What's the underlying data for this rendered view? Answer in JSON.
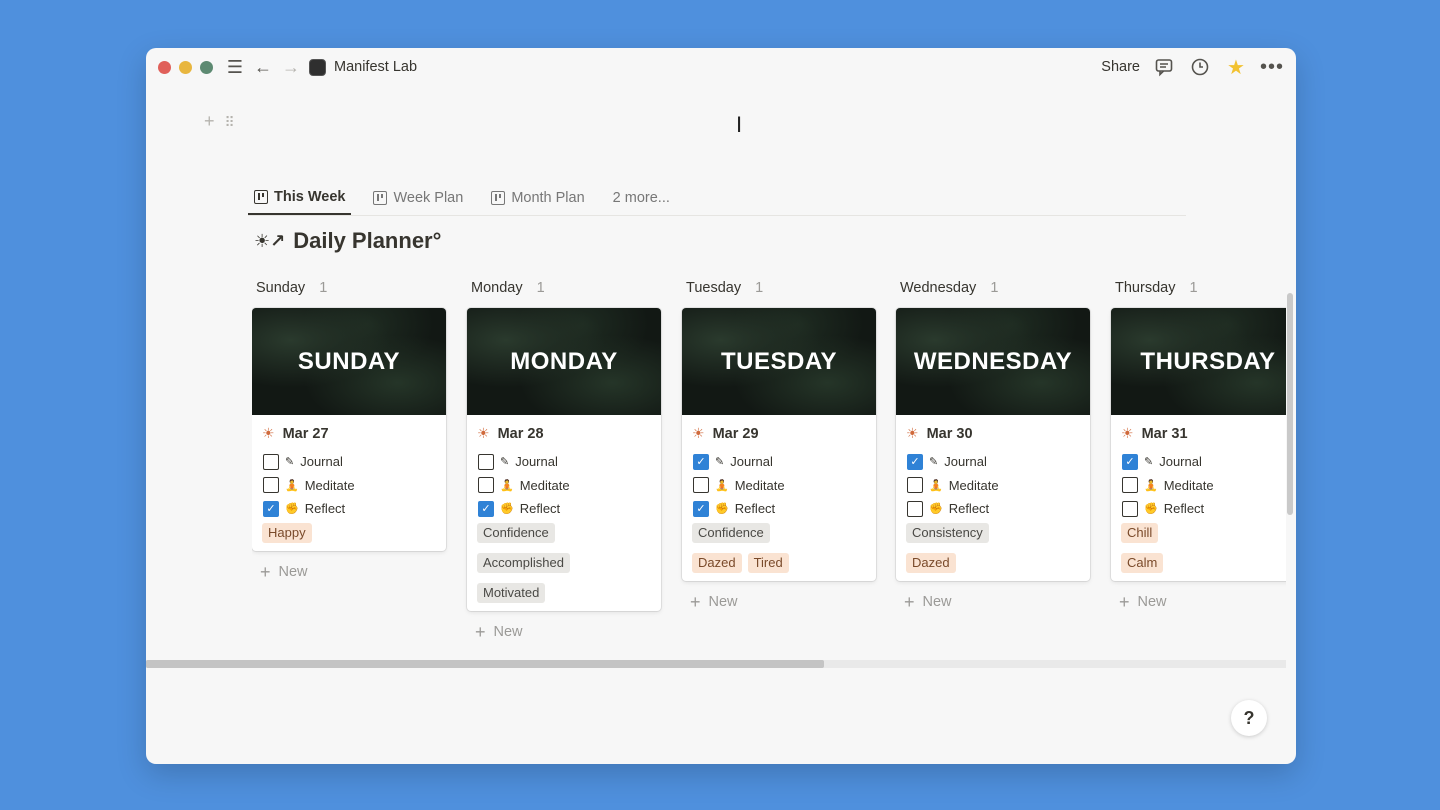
{
  "window": {
    "traffic_lights": [
      "#e0605a",
      "#e8b63f",
      "#5d8a72"
    ],
    "title": "Manifest Lab",
    "share_label": "Share"
  },
  "tabs": [
    {
      "label": "This Week",
      "active": true
    },
    {
      "label": "Week Plan",
      "active": false
    },
    {
      "label": "Month Plan",
      "active": false
    },
    {
      "label": "2 more...",
      "active": false
    }
  ],
  "page_title": "Daily Planner°",
  "columns": [
    {
      "name": "Sunday",
      "count": "1",
      "cover": "SUNDAY",
      "date": "Mar 27",
      "todos": [
        {
          "label": "Journal",
          "checked": false
        },
        {
          "label": "Meditate",
          "checked": false
        },
        {
          "label": "Reflect",
          "checked": true
        }
      ],
      "tags": [
        {
          "label": "Happy",
          "color": "orange"
        }
      ],
      "new_label": "New"
    },
    {
      "name": "Monday",
      "count": "1",
      "cover": "MONDAY",
      "date": "Mar 28",
      "todos": [
        {
          "label": "Journal",
          "checked": false
        },
        {
          "label": "Meditate",
          "checked": false
        },
        {
          "label": "Reflect",
          "checked": true
        }
      ],
      "tags": [
        {
          "label": "Confidence",
          "color": "gray"
        },
        {
          "label": "Accomplished",
          "color": "gray"
        },
        {
          "label": "Motivated",
          "color": "gray"
        }
      ],
      "new_label": "New"
    },
    {
      "name": "Tuesday",
      "count": "1",
      "cover": "TUESDAY",
      "date": "Mar 29",
      "todos": [
        {
          "label": "Journal",
          "checked": true
        },
        {
          "label": "Meditate",
          "checked": false
        },
        {
          "label": "Reflect",
          "checked": true
        }
      ],
      "tags": [
        {
          "label": "Confidence",
          "color": "gray"
        },
        {
          "label": "Dazed",
          "color": "orange"
        },
        {
          "label": "Tired",
          "color": "orange"
        }
      ],
      "new_label": "New"
    },
    {
      "name": "Wednesday",
      "count": "1",
      "cover": "WEDNESDAY",
      "date": "Mar 30",
      "todos": [
        {
          "label": "Journal",
          "checked": true
        },
        {
          "label": "Meditate",
          "checked": false
        },
        {
          "label": "Reflect",
          "checked": false
        }
      ],
      "tags": [
        {
          "label": "Consistency",
          "color": "gray"
        },
        {
          "label": "Dazed",
          "color": "orange"
        }
      ],
      "new_label": "New"
    },
    {
      "name": "Thursday",
      "count": "1",
      "cover": "THURSDAY",
      "date": "Mar 31",
      "todos": [
        {
          "label": "Journal",
          "checked": true
        },
        {
          "label": "Meditate",
          "checked": false
        },
        {
          "label": "Reflect",
          "checked": false
        }
      ],
      "tags": [
        {
          "label": "Chill",
          "color": "orange"
        },
        {
          "label": "Calm",
          "color": "orange"
        }
      ],
      "new_label": "New"
    }
  ],
  "help_label": "?"
}
